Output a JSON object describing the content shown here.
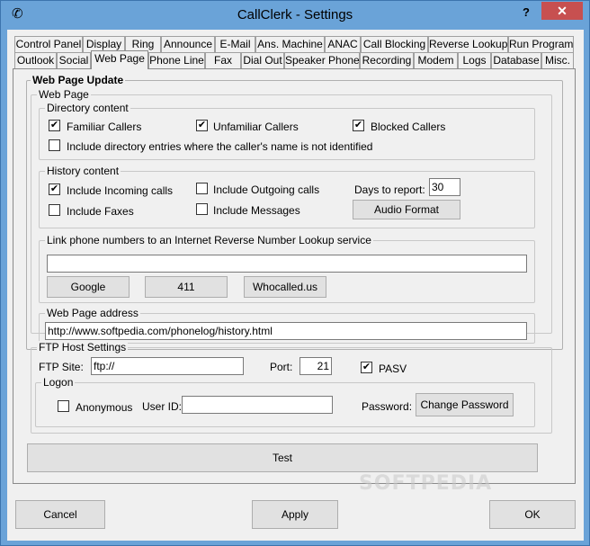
{
  "window": {
    "title": "CallClerk - Settings",
    "help_label": "?",
    "close_label": "✕",
    "app_icon_glyph": "✆"
  },
  "tabs_row1": [
    "Control Panel",
    "Display",
    "Ring",
    "Announce",
    "E-Mail",
    "Ans. Machine",
    "ANAC",
    "Call Blocking",
    "Reverse Lookup",
    "Run Program"
  ],
  "tabs_row2": [
    "Outlook",
    "Social",
    "Web Page",
    "Phone Line",
    "Fax",
    "Dial Out",
    "Speaker Phone",
    "Recording",
    "Modem",
    "Logs",
    "Database",
    "Misc."
  ],
  "active_tab": "Web Page",
  "panel": {
    "heading": "Web Page Update",
    "web_page_group": "Web Page",
    "directory": {
      "label": "Directory content",
      "familiar": {
        "label": "Familiar Callers",
        "checked": true
      },
      "unfamiliar": {
        "label": "Unfamiliar Callers",
        "checked": true
      },
      "blocked": {
        "label": "Blocked Callers",
        "checked": true
      },
      "unidentified": {
        "label": "Include directory entries where the caller's name is not identified",
        "checked": false
      }
    },
    "history": {
      "label": "History content",
      "incoming": {
        "label": "Include Incoming calls",
        "checked": true
      },
      "outgoing": {
        "label": "Include Outgoing calls",
        "checked": false
      },
      "faxes": {
        "label": "Include Faxes",
        "checked": false
      },
      "messages": {
        "label": "Include Messages",
        "checked": false
      },
      "days_label": "Days to report:",
      "days_value": "30",
      "audio_format_label": "Audio Format"
    },
    "lookup": {
      "label": "Link phone numbers to an Internet Reverse Number Lookup service",
      "value": "",
      "google_label": "Google",
      "411_label": "411",
      "whocalled_label": "Whocalled.us"
    },
    "address": {
      "label": "Web Page address",
      "value": "http://www.softpedia.com/phonelog/history.html"
    },
    "ftp": {
      "label": "FTP Host Settings",
      "site_label": "FTP Site:",
      "site_value": "ftp://",
      "port_label": "Port:",
      "port_value": "21",
      "pasv": {
        "label": "PASV",
        "checked": true
      },
      "logon_label": "Logon",
      "anonymous": {
        "label": "Anonymous",
        "checked": false
      },
      "userid_label": "User ID:",
      "userid_value": "",
      "password_label": "Password:",
      "change_password_label": "Change Password"
    },
    "test_label": "Test"
  },
  "footer": {
    "cancel_label": "Cancel",
    "apply_label": "Apply",
    "ok_label": "OK"
  },
  "watermark": "SOFTPEDIA"
}
